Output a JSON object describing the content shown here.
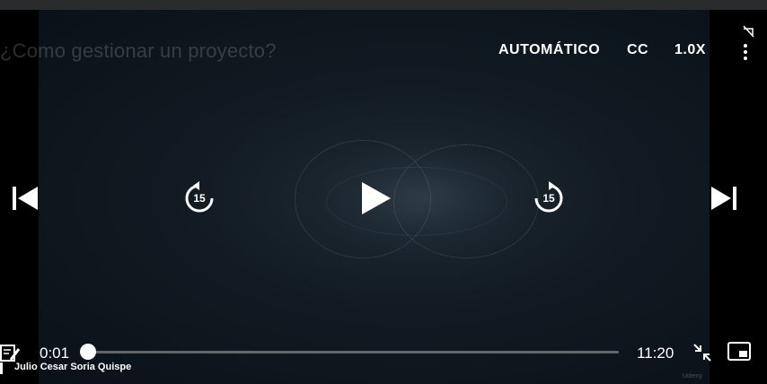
{
  "video": {
    "title": "¿Como gestionar un proyecto?",
    "watermark": "Udemy"
  },
  "controls": {
    "quality_label": "AUTOMÁTICO",
    "captions_label": "CC",
    "speed_label": "1.0X",
    "rewind_seconds": "15",
    "forward_seconds": "15"
  },
  "progress": {
    "current_time": "0:01",
    "duration": "11:20",
    "played_fraction": 0.0015
  },
  "student": {
    "name": "Julio Cesar Soria Quispe"
  },
  "icons": {
    "more": "more-vertical-icon",
    "cast_off": "cast-off-icon",
    "prev": "skip-previous-icon",
    "next": "skip-next-icon",
    "rewind": "replay-15-icon",
    "forward": "forward-15-icon",
    "play": "play-icon",
    "notes": "notes-icon",
    "exit_fullscreen": "exit-fullscreen-icon",
    "pip": "picture-in-picture-icon"
  },
  "colors": {
    "accent": "#ffffff",
    "background": "#000000"
  }
}
